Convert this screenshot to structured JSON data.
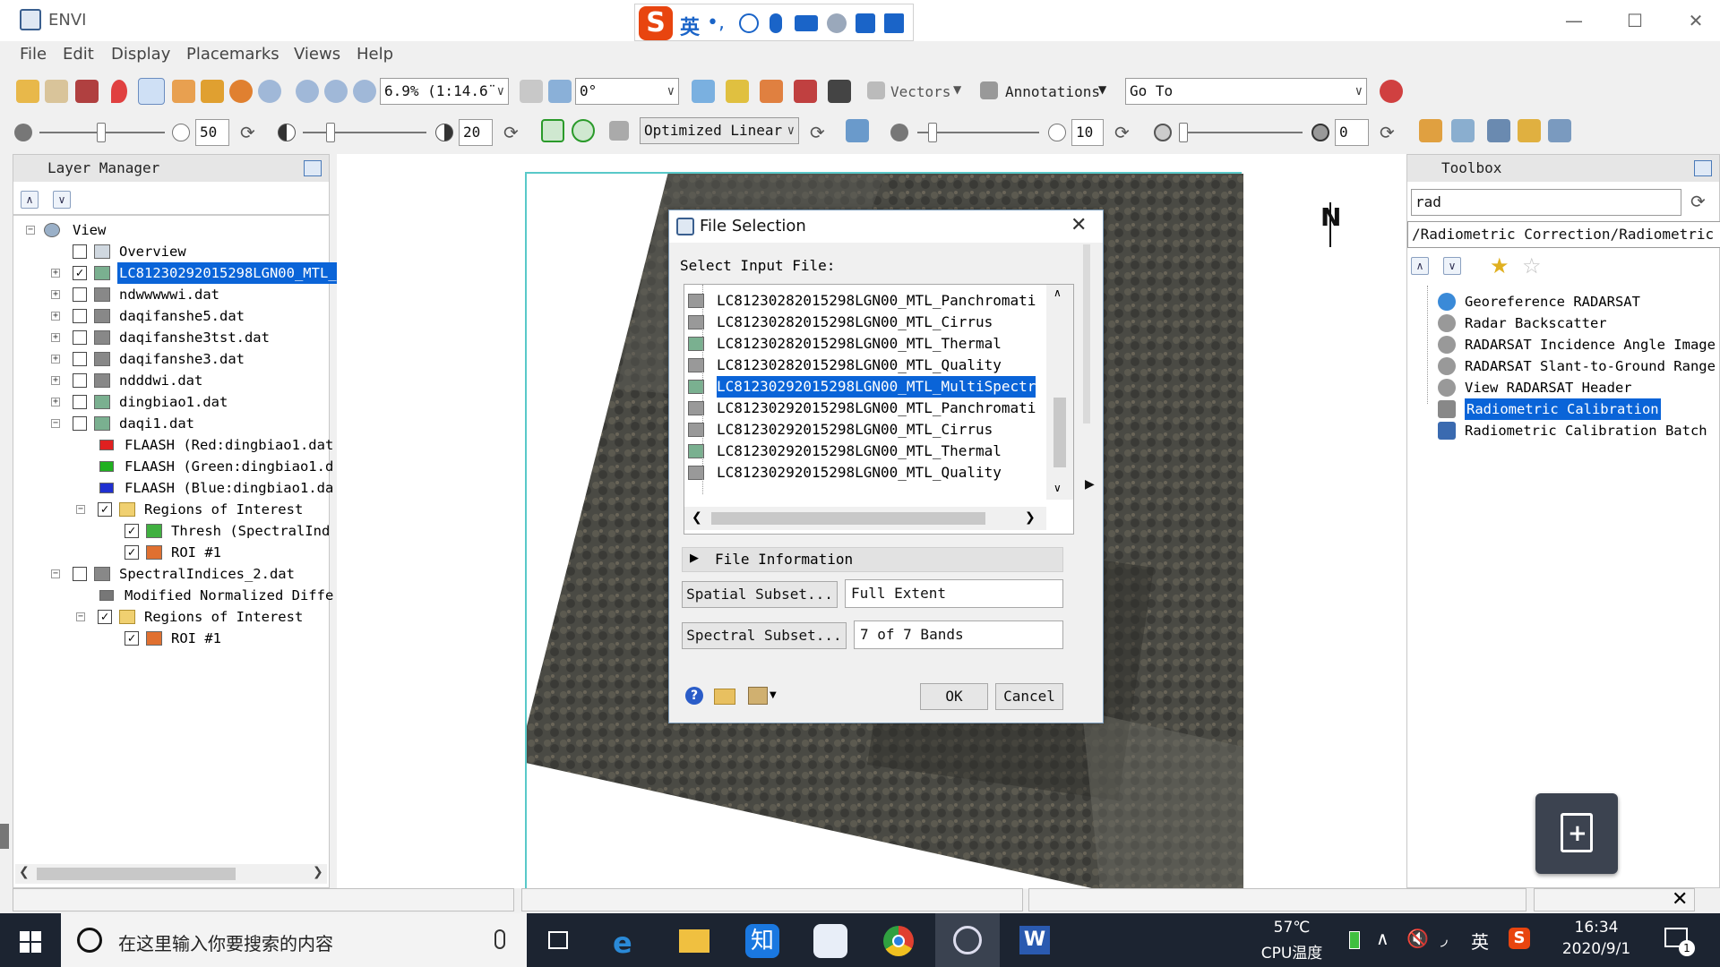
{
  "window": {
    "title": "ENVI"
  },
  "ime": {
    "lang": "英"
  },
  "menu": [
    "File",
    "Edit",
    "Display",
    "Placemarks",
    "Views",
    "Help"
  ],
  "toolbar1": {
    "zoom": "6.9% (1:14.6̈",
    "rotation": "0°",
    "vectors": "Vectors",
    "annotations": "Annotations",
    "goto": "Go To"
  },
  "toolbar2": {
    "brightness": "50",
    "contrast": "20",
    "stretch": "Optimized Linear",
    "sharpen": "10",
    "transparency": "0"
  },
  "layer_manager": {
    "title": "Layer Manager",
    "rows": [
      {
        "label": "View"
      },
      {
        "label": "Overview"
      },
      {
        "label": "LC81230292015298LGN00_MTL_"
      },
      {
        "label": "ndwwwwwi.dat"
      },
      {
        "label": "daqifanshe5.dat"
      },
      {
        "label": "daqifanshe3tst.dat"
      },
      {
        "label": "daqifanshe3.dat"
      },
      {
        "label": "ndddwi.dat"
      },
      {
        "label": "dingbiao1.dat"
      },
      {
        "label": "daqi1.dat"
      },
      {
        "label": "FLAASH (Red:dingbiao1.dat"
      },
      {
        "label": "FLAASH (Green:dingbiao1.d"
      },
      {
        "label": "FLAASH (Blue:dingbiao1.da"
      },
      {
        "label": "Regions of Interest"
      },
      {
        "label": "Thresh (SpectralInd"
      },
      {
        "label": "ROI #1"
      },
      {
        "label": "SpectralIndices_2.dat"
      },
      {
        "label": "Modified Normalized Diffe"
      },
      {
        "label": "Regions of Interest"
      },
      {
        "label": "ROI #1"
      }
    ]
  },
  "dialog": {
    "title": "File Selection",
    "prompt": "Select Input File:",
    "files": [
      "LC81230282015298LGN00_MTL_Panchromati",
      "LC81230282015298LGN00_MTL_Cirrus",
      "LC81230282015298LGN00_MTL_Thermal",
      "LC81230282015298LGN00_MTL_Quality",
      "LC81230292015298LGN00_MTL_MultiSpectr",
      "LC81230292015298LGN00_MTL_Panchromati",
      "LC81230292015298LGN00_MTL_Cirrus",
      "LC81230292015298LGN00_MTL_Thermal",
      "LC81230292015298LGN00_MTL_Quality"
    ],
    "file_info": "File Information",
    "spatial_btn": "Spatial Subset...",
    "spatial_val": "Full Extent",
    "spectral_btn": "Spectral Subset...",
    "spectral_val": "7 of 7 Bands",
    "ok": "OK",
    "cancel": "Cancel"
  },
  "toolbox": {
    "title": "Toolbox",
    "search": "rad",
    "path": "/Radiometric Correction/Radiometric Cal",
    "items": [
      "Georeference RADARSAT",
      "Radar Backscatter",
      "RADARSAT Incidence Angle Image",
      "RADARSAT Slant-to-Ground Range",
      "View RADARSAT Header",
      "Radiometric Calibration",
      "Radiometric Calibration Batch"
    ]
  },
  "north_label": "N",
  "taskbar": {
    "search_placeholder": "在这里输入你要搜索的内容",
    "temp": "57℃",
    "temp_label": "CPU温度",
    "ime_tray": "英",
    "time": "16:34",
    "date": "2020/9/1",
    "notif_count": "1",
    "zhi": "知"
  },
  "colors": {
    "selection": "#0a64d8",
    "taskbar": "#1c2431",
    "frame": "#59c9c9"
  }
}
